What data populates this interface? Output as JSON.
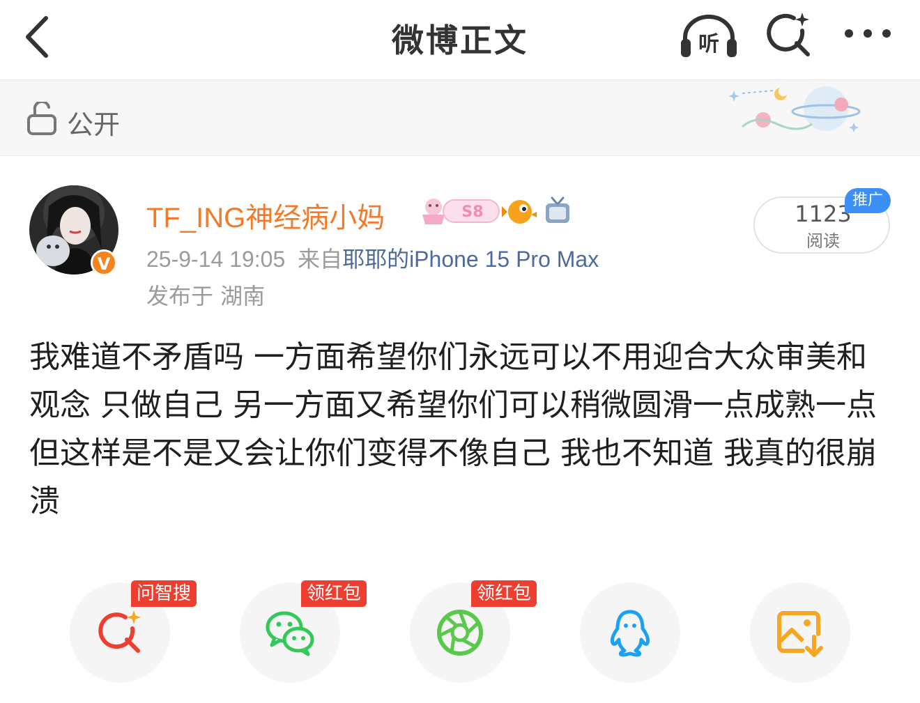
{
  "header": {
    "title": "微博正文",
    "listen_label": "听"
  },
  "visibility": {
    "label": "公开"
  },
  "author": {
    "name": "TF_ING神经病小妈",
    "verified_badge": "V",
    "member_badge": "S8",
    "timestamp": "25-9-14 19:05",
    "source_prefix": "来自",
    "device": "耶耶的iPhone 15 Pro Max",
    "location": "发布于 湖南"
  },
  "read_stats": {
    "count": "1123",
    "label": "阅读",
    "promo_tag": "推广"
  },
  "post": {
    "text": "我难道不矛盾吗 一方面希望你们永远可以不用迎合大众审美和观念 只做自己 另一方面又希望你们可以稍微圆滑一点成熟一点 但这样是不是又会让你们变得不像自己 我也不知道 我真的很崩溃"
  },
  "share_bar": {
    "items": [
      {
        "name": "zhisou",
        "icon": "sparkle-search-icon",
        "tag": "问智搜",
        "color": "#ee3e30"
      },
      {
        "name": "wechat",
        "icon": "wechat-icon",
        "tag": "领红包",
        "color": "#34c759"
      },
      {
        "name": "moments",
        "icon": "moments-aperture-icon",
        "tag": "领红包",
        "color": "#5ac84b"
      },
      {
        "name": "qq",
        "icon": "qq-penguin-icon",
        "tag": "",
        "color": "#1aa1f5"
      },
      {
        "name": "save-image",
        "icon": "save-image-icon",
        "tag": "",
        "color": "#f5a623"
      }
    ]
  },
  "colors": {
    "username": "#f27a2a",
    "device_link": "#4c6a9b",
    "promo": "#3b8ff5",
    "tag_red": "#ee3e30"
  }
}
